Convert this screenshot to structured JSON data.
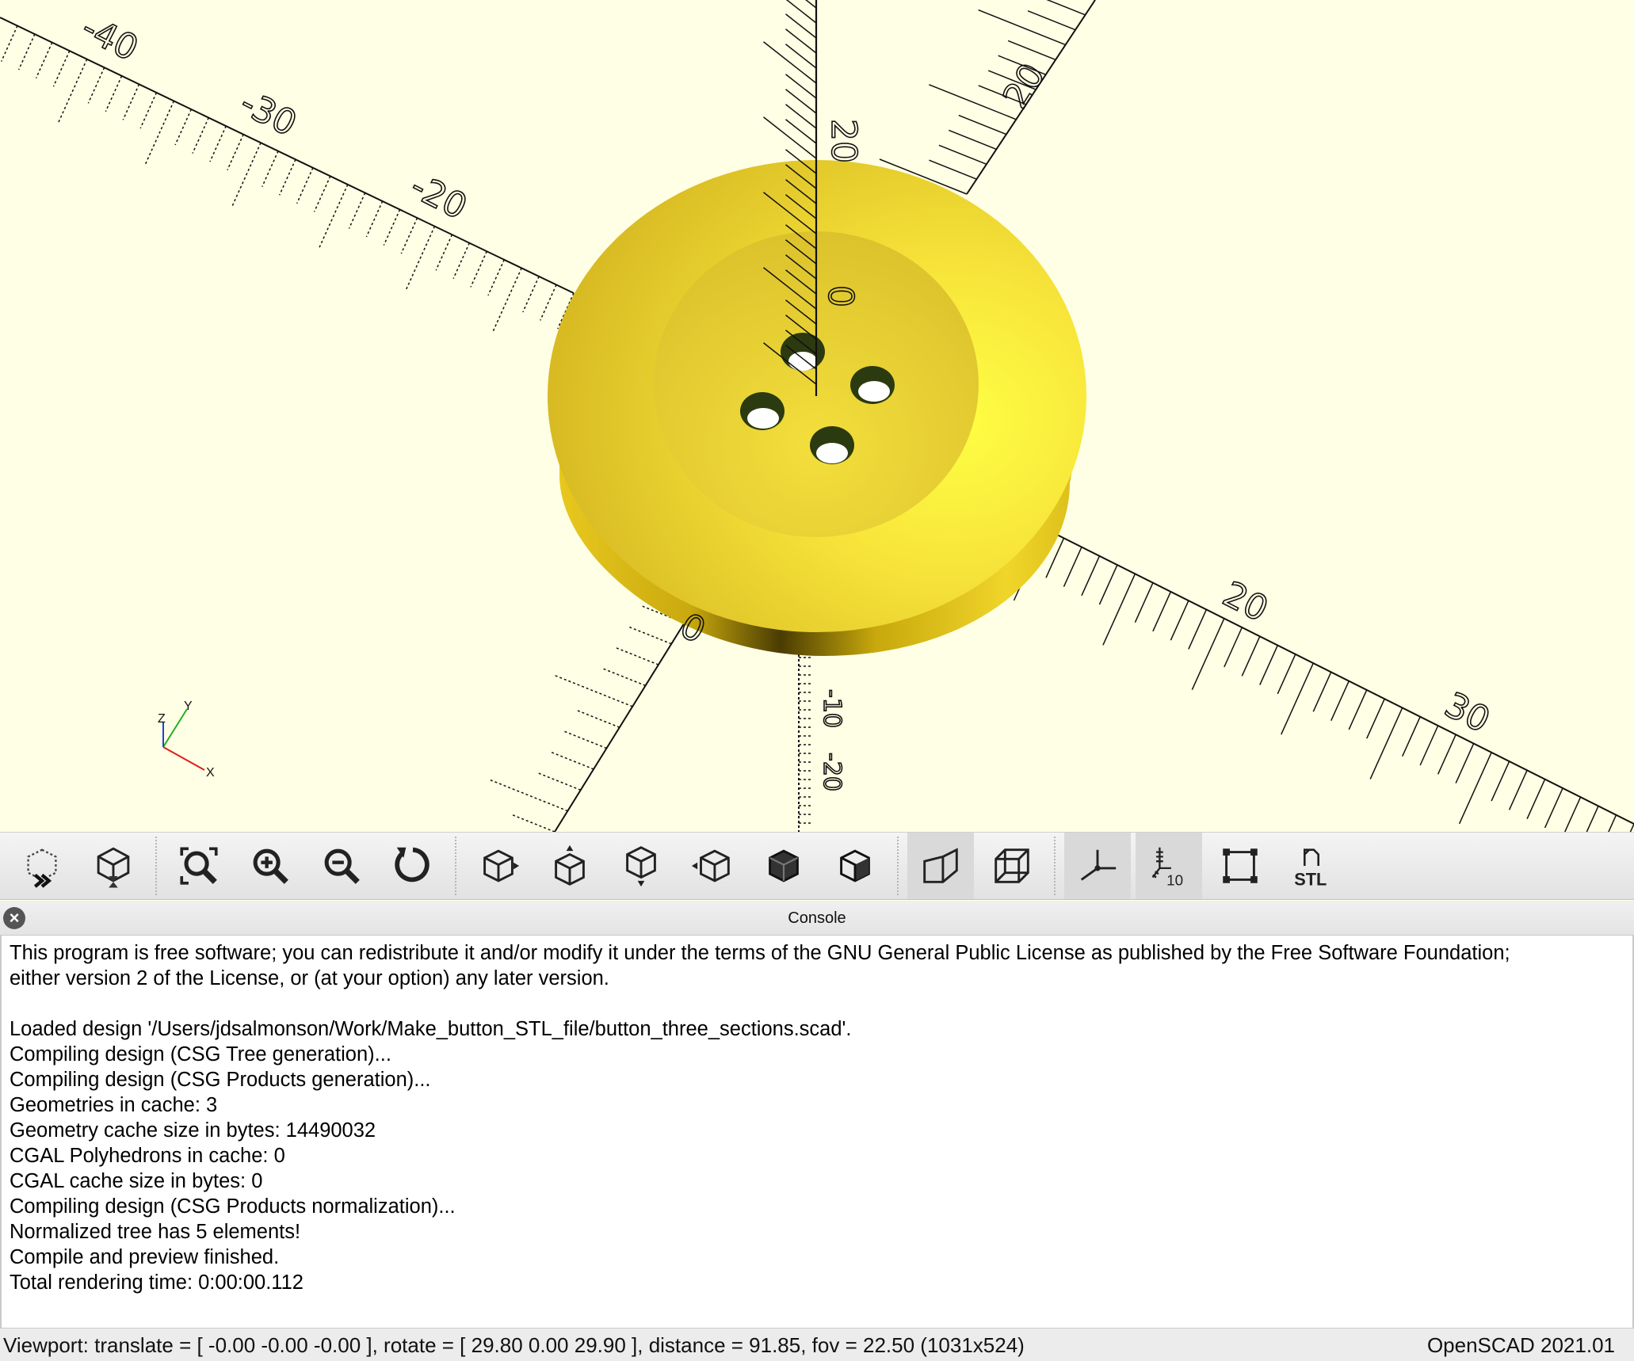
{
  "viewport": {
    "axis_labels": {
      "x_neg": [
        "-40",
        "-30",
        "-20"
      ],
      "x_pos": [
        "20",
        "30"
      ],
      "y_pos": [
        "20"
      ],
      "z_pos": [
        "20",
        "0"
      ],
      "origin_x": "0",
      "z_neg": [
        "-10",
        "-20"
      ]
    },
    "axes_indicator": {
      "x": "X",
      "y": "Y",
      "z": "Z"
    },
    "model_color": "#f5e03a",
    "background_color": "#ffffe5"
  },
  "toolbar": {
    "buttons": [
      {
        "icon": "preview-icon",
        "active": false
      },
      {
        "icon": "render-icon",
        "active": false
      },
      {
        "icon": "view-all-icon",
        "active": false
      },
      {
        "icon": "zoom-in-icon",
        "active": false
      },
      {
        "icon": "zoom-out-icon",
        "active": false
      },
      {
        "icon": "reset-view-icon",
        "active": false
      },
      {
        "icon": "view-right-icon",
        "active": false
      },
      {
        "icon": "view-top-icon",
        "active": false
      },
      {
        "icon": "view-bottom-icon",
        "active": false
      },
      {
        "icon": "view-left-icon",
        "active": false
      },
      {
        "icon": "view-front-icon",
        "active": false
      },
      {
        "icon": "view-back-icon",
        "active": false
      },
      {
        "icon": "perspective-icon",
        "active": true
      },
      {
        "icon": "orthogonal-icon",
        "active": false
      },
      {
        "icon": "show-axes-icon",
        "active": true
      },
      {
        "icon": "show-scale-markers-icon",
        "active": true,
        "label": "10"
      },
      {
        "icon": "show-edges-icon",
        "active": false
      },
      {
        "icon": "export-stl-icon",
        "active": false,
        "label": "STL"
      }
    ]
  },
  "console": {
    "title": "Console",
    "close_glyph": "×",
    "lines": [
      "This program is free software; you can redistribute it and/or modify it under the terms of the GNU General Public License as published by the Free Software Foundation;",
      "either version 2 of the License, or (at your option) any later version.",
      "",
      "Loaded design '/Users/jdsalmonson/Work/Make_button_STL_file/button_three_sections.scad'.",
      "Compiling design (CSG Tree generation)...",
      "Compiling design (CSG Products generation)...",
      "Geometries in cache: 3",
      "Geometry cache size in bytes: 14490032",
      "CGAL Polyhedrons in cache: 0",
      "CGAL cache size in bytes: 0",
      "Compiling design (CSG Products normalization)...",
      "Normalized tree has 5 elements!",
      "Compile and preview finished.",
      "Total rendering time: 0:00:00.112"
    ]
  },
  "statusbar": {
    "viewport_info": "Viewport: translate = [ -0.00 -0.00 -0.00 ], rotate = [ 29.80 0.00 29.90 ], distance = 91.85, fov = 22.50 (1031x524)",
    "version": "OpenSCAD 2021.01"
  }
}
